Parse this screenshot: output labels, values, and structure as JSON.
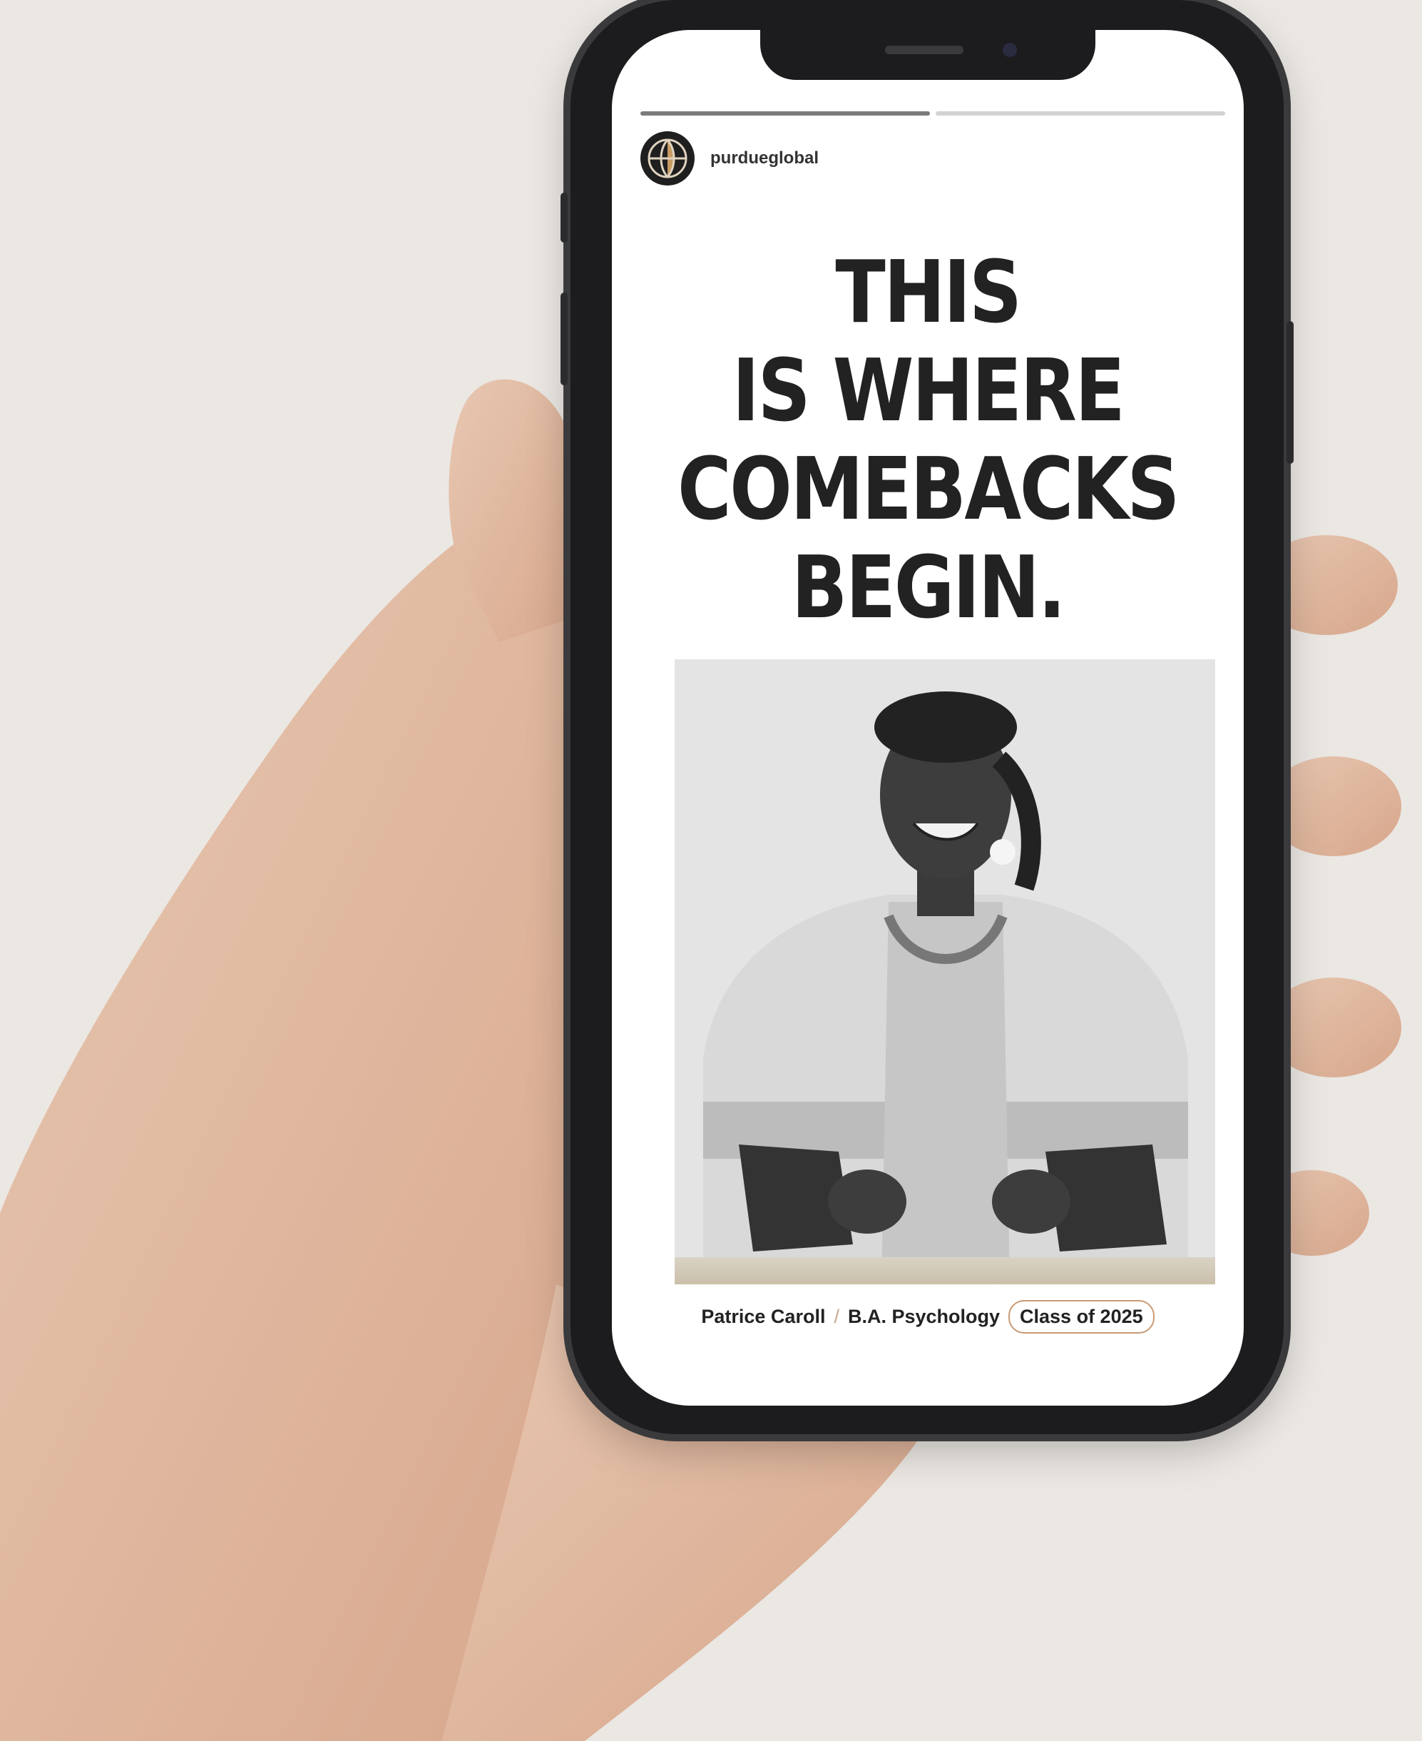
{
  "story": {
    "username": "purdueglobal",
    "progress": [
      1.0,
      0.0
    ]
  },
  "post": {
    "headline_lines": [
      "THIS",
      "IS WHERE",
      "COMEBACKS",
      "BEGIN."
    ],
    "caption": {
      "name": "Patrice Caroll",
      "separator": "/",
      "degree": "B.A. Psychology",
      "class_badge": "Class of 2025"
    },
    "photo_description_icon": "portrait-photo"
  },
  "colors": {
    "background": "#ebe7e3",
    "phone_frame": "#1c1c1e",
    "headline_text": "#222222",
    "badge_border": "#c99a75"
  }
}
